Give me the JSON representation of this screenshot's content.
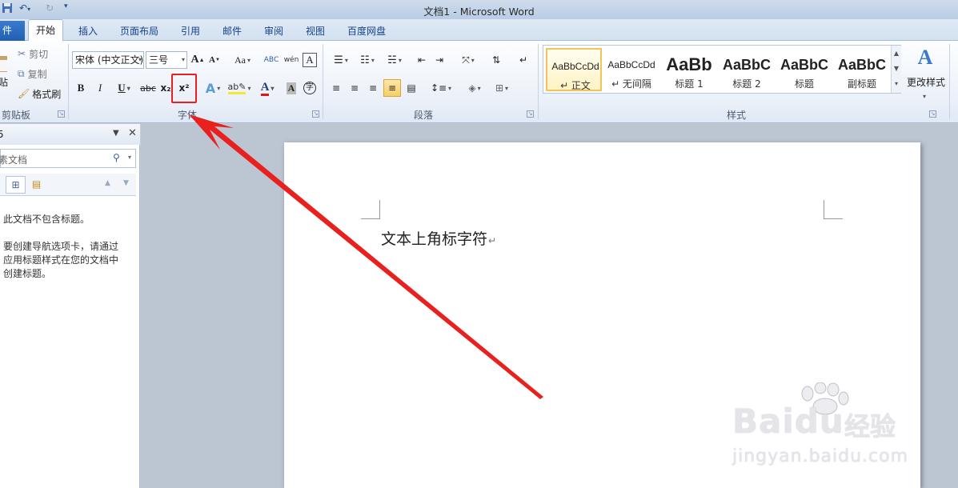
{
  "window": {
    "title": "文档1 - Microsoft Word"
  },
  "tabs": {
    "file": "件",
    "home": "开始",
    "insert": "插入",
    "layout": "页面布局",
    "references": "引用",
    "mailings": "邮件",
    "review": "审阅",
    "view": "视图",
    "baidu": "百度网盘"
  },
  "clipboard": {
    "cut": "剪切",
    "copy": "复制",
    "paste": "贴",
    "format_painter": "格式刷",
    "group_label": "剪贴板"
  },
  "font": {
    "font_name": "宋体 (中文正文)",
    "font_size": "三号",
    "group_label": "字体",
    "change_case": "Aa",
    "bold": "B",
    "italic": "I",
    "underline": "U",
    "strike": "abc",
    "subscript": "x₂",
    "superscript": "x²",
    "grow": "A",
    "shrink": "A",
    "clear": "A",
    "font_color": "A",
    "char_shade": "A",
    "enclose": "字"
  },
  "paragraph": {
    "group_label": "段落"
  },
  "styles": {
    "group_label": "样式",
    "items": [
      {
        "sample": "AaBbCcDd",
        "name": "↵ 正文"
      },
      {
        "sample": "AaBbCcDd",
        "name": "↵ 无间隔"
      },
      {
        "sample": "AaBb",
        "name": "标题 1"
      },
      {
        "sample": "AaBbC",
        "name": "标题 2"
      },
      {
        "sample": "AaBbC",
        "name": "标题"
      },
      {
        "sample": "AaBbC",
        "name": "副标题"
      }
    ],
    "change_styles": "更改样式"
  },
  "nav": {
    "title": "5",
    "search_placeholder": "素文档",
    "line1": "此文档不包含标题。",
    "line2": "要创建导航选项卡，请通过",
    "line3": "应用标题样式在您的文档中",
    "line4": "创建标题。"
  },
  "document": {
    "text": "文本上角标字符",
    "para_mark": "↵"
  },
  "watermark": {
    "brand_a": "Bai",
    "brand_b": "du",
    "brand_c": "经验",
    "url": "jingyan.baidu.com"
  },
  "colors": {
    "highlight": "#e8201e",
    "arrow": "#e8201e",
    "accent": "#1f5fb4"
  }
}
